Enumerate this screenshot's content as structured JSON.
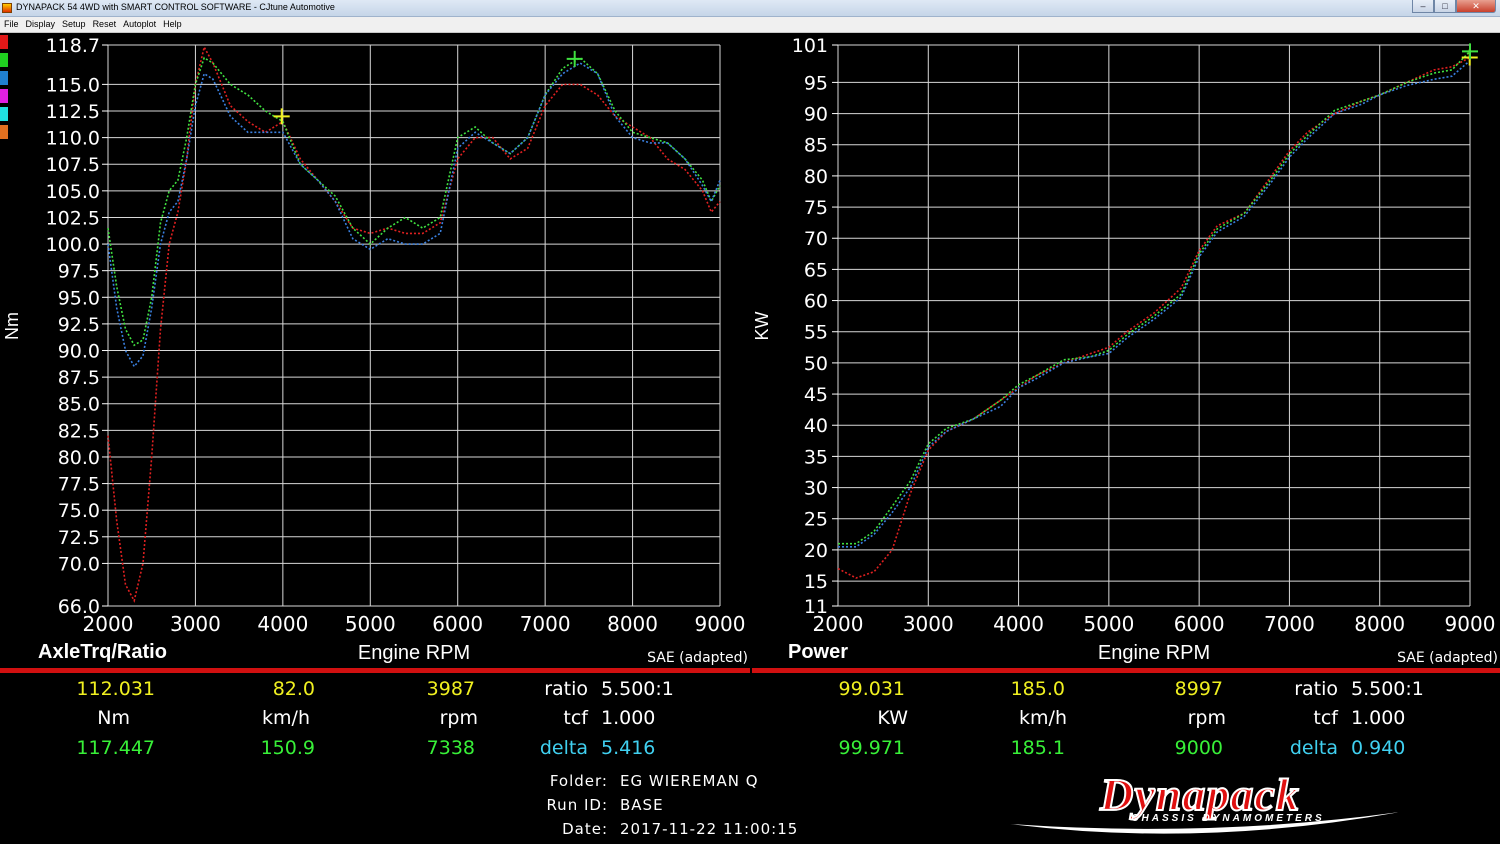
{
  "window": {
    "title": "DYNAPACK 54 4WD with SMART CONTROL SOFTWARE - CJtune Automotive",
    "menu": [
      "File",
      "Display",
      "Setup",
      "Reset",
      "Autoplot",
      "Help"
    ]
  },
  "legend_colors": [
    "#e01818",
    "#20d020",
    "#2080d0",
    "#e020e0",
    "#20e0e0",
    "#e07020"
  ],
  "colors": {
    "run_red": "#e02020",
    "run_green": "#40e040",
    "run_blue": "#3a80e0",
    "separator": "#d01010",
    "grid": "#d8d8d8"
  },
  "chart_data": [
    {
      "type": "line",
      "panel_title": "AxleTrq/Ratio",
      "xlabel": "Engine RPM",
      "ylabel": "Nm",
      "correction": "SAE (adapted)",
      "xlim": [
        2000,
        9000
      ],
      "ylim": [
        66.0,
        118.7
      ],
      "x_ticks": [
        2000,
        3000,
        4000,
        5000,
        6000,
        7000,
        8000,
        9000
      ],
      "y_ticks": [
        "66.0",
        "70.0",
        "72.5",
        "75.0",
        "77.5",
        "80.0",
        "82.5",
        "85.0",
        "87.5",
        "90.0",
        "92.5",
        "95.0",
        "97.5",
        "100.0",
        "102.5",
        "105.0",
        "107.5",
        "110.0",
        "112.5",
        "115.0",
        "118.7"
      ],
      "series": [
        {
          "color": "#e02020",
          "x": [
            2000,
            2100,
            2200,
            2300,
            2400,
            2500,
            2600,
            2700,
            2800,
            2900,
            3000,
            3100,
            3200,
            3400,
            3600,
            3800,
            4000,
            4200,
            4400,
            4600,
            4800,
            5000,
            5200,
            5400,
            5600,
            5800,
            6000,
            6200,
            6400,
            6600,
            6800,
            7000,
            7200,
            7400,
            7600,
            7800,
            8000,
            8200,
            8400,
            8600,
            8800,
            8900,
            9000
          ],
          "y": [
            82,
            74,
            68,
            66.5,
            70,
            80,
            92,
            100,
            103,
            108,
            115,
            118.5,
            117,
            113,
            111.5,
            110.5,
            111.5,
            108,
            106,
            104,
            101.5,
            101,
            101.5,
            101,
            101,
            102,
            108,
            110,
            110,
            108,
            109,
            113,
            115,
            115,
            114,
            112,
            111,
            110,
            108,
            107,
            105,
            103,
            104
          ]
        },
        {
          "color": "#40e040",
          "x": [
            2000,
            2100,
            2200,
            2300,
            2400,
            2500,
            2600,
            2700,
            2800,
            2900,
            3000,
            3100,
            3200,
            3400,
            3600,
            3800,
            4000,
            4200,
            4400,
            4600,
            4800,
            5000,
            5200,
            5400,
            5600,
            5800,
            6000,
            6200,
            6400,
            6600,
            6800,
            7000,
            7200,
            7400,
            7600,
            7800,
            8000,
            8200,
            8400,
            8600,
            8800,
            8900,
            9000
          ],
          "y": [
            101.5,
            96,
            92,
            90.5,
            91,
            95,
            102,
            105,
            106,
            110,
            115,
            117.5,
            117,
            115,
            114,
            112.5,
            111.5,
            107.5,
            106,
            104.5,
            101.5,
            100,
            101.5,
            102.5,
            101.5,
            102.5,
            110,
            111,
            109.5,
            108.5,
            110,
            114,
            116.5,
            117.5,
            116,
            112.5,
            110.5,
            110,
            109.5,
            108,
            106,
            104,
            105.5
          ]
        },
        {
          "color": "#3a80e0",
          "x": [
            2000,
            2100,
            2200,
            2300,
            2400,
            2500,
            2600,
            2700,
            2800,
            2900,
            3000,
            3100,
            3200,
            3400,
            3600,
            3800,
            4000,
            4200,
            4400,
            4600,
            4800,
            5000,
            5200,
            5400,
            5600,
            5800,
            6000,
            6200,
            6400,
            6600,
            6800,
            7000,
            7200,
            7400,
            7600,
            7800,
            8000,
            8200,
            8400,
            8600,
            8800,
            8900,
            9000
          ],
          "y": [
            100,
            94,
            90,
            88.5,
            89.5,
            94,
            100,
            103,
            104,
            108,
            113,
            116,
            115.5,
            112,
            110.5,
            110.5,
            110.5,
            107.5,
            106,
            104,
            100.5,
            99.5,
            100.5,
            100,
            100,
            101,
            109,
            110.5,
            109.5,
            108.5,
            110,
            114,
            116,
            117,
            116,
            112,
            110,
            109.5,
            109.5,
            108,
            105.5,
            104,
            106
          ]
        }
      ],
      "markers": [
        {
          "label": "cursor",
          "x": 3987,
          "y": 112.0,
          "color": "#f0f020"
        },
        {
          "label": "peak",
          "x": 7338,
          "y": 117.4,
          "color": "#40e040"
        }
      ]
    },
    {
      "type": "line",
      "panel_title": "Power",
      "xlabel": "Engine RPM",
      "ylabel": "KW",
      "correction": "SAE (adapted)",
      "xlim": [
        2000,
        9000
      ],
      "ylim": [
        11,
        101
      ],
      "x_ticks": [
        2000,
        3000,
        4000,
        5000,
        6000,
        7000,
        8000,
        9000
      ],
      "y_ticks": [
        "11",
        "15",
        "20",
        "25",
        "30",
        "35",
        "40",
        "45",
        "50",
        "55",
        "60",
        "65",
        "70",
        "75",
        "80",
        "85",
        "90",
        "95",
        "101"
      ],
      "series": [
        {
          "color": "#e02020",
          "x": [
            2000,
            2200,
            2400,
            2600,
            2800,
            3000,
            3200,
            3500,
            3800,
            4000,
            4200,
            4500,
            4800,
            5000,
            5200,
            5500,
            5800,
            6000,
            6200,
            6500,
            6800,
            7000,
            7200,
            7500,
            7800,
            8000,
            8300,
            8600,
            8800,
            9000
          ],
          "y": [
            17,
            15.5,
            16.5,
            20,
            29,
            36,
            39,
            41,
            44,
            46,
            48,
            50,
            51.5,
            52.5,
            55,
            58,
            62,
            68,
            72,
            74,
            80,
            84,
            87,
            90,
            92,
            93,
            95,
            97,
            97.5,
            99
          ]
        },
        {
          "color": "#40e040",
          "x": [
            2000,
            2200,
            2400,
            2600,
            2800,
            3000,
            3200,
            3500,
            3800,
            4000,
            4200,
            4500,
            4800,
            5000,
            5200,
            5500,
            5800,
            6000,
            6200,
            6500,
            6800,
            7000,
            7200,
            7500,
            7800,
            8000,
            8300,
            8600,
            8800,
            9000
          ],
          "y": [
            21,
            21,
            23,
            27,
            31,
            37,
            39.5,
            41,
            44,
            46.5,
            48,
            50.5,
            51,
            52,
            54.5,
            57.5,
            61,
            67.5,
            71.5,
            74,
            79.5,
            83.5,
            86.5,
            90.5,
            92,
            93,
            95,
            96.5,
            97,
            100
          ]
        },
        {
          "color": "#3a80e0",
          "x": [
            2000,
            2200,
            2400,
            2600,
            2800,
            3000,
            3200,
            3500,
            3800,
            4000,
            4200,
            4500,
            4800,
            5000,
            5200,
            5500,
            5800,
            6000,
            6200,
            6500,
            6800,
            7000,
            7200,
            7500,
            7800,
            8000,
            8300,
            8600,
            8800,
            9000
          ],
          "y": [
            20.5,
            20.5,
            22.5,
            26,
            30,
            36.5,
            39,
            41,
            43,
            46,
            47.5,
            50,
            51,
            51.5,
            54,
            57,
            60.5,
            67,
            71,
            73.5,
            79,
            83,
            86,
            90,
            91.5,
            93,
            94.5,
            95.5,
            96,
            98.5
          ]
        }
      ],
      "markers": [
        {
          "label": "cursor",
          "x": 8997,
          "y": 99.0,
          "color": "#f0f020"
        },
        {
          "label": "peak",
          "x": 9000,
          "y": 99.97,
          "color": "#40e040"
        }
      ]
    }
  ],
  "readouts": {
    "left": {
      "cursor": {
        "torque": "112.031",
        "speed": "82.0",
        "rpm": "3987"
      },
      "units": {
        "torque": "Nm",
        "speed": "km/h",
        "rpm": "rpm"
      },
      "peak": {
        "torque": "117.447",
        "speed": "150.9",
        "rpm": "7338"
      },
      "ratio_label": "ratio",
      "ratio": "5.500:1",
      "tcf_label": "tcf",
      "tcf": "1.000",
      "delta_label": "delta",
      "delta": "5.416"
    },
    "right": {
      "cursor": {
        "power": "99.031",
        "speed": "185.0",
        "rpm": "8997"
      },
      "units": {
        "power": "KW",
        "speed": "km/h",
        "rpm": "rpm"
      },
      "peak": {
        "power": "99.971",
        "speed": "185.1",
        "rpm": "9000"
      },
      "ratio_label": "ratio",
      "ratio": "5.500:1",
      "tcf_label": "tcf",
      "tcf": "1.000",
      "delta_label": "delta",
      "delta": "0.940"
    }
  },
  "run_info": {
    "folder_label": "Folder:",
    "folder": "EG WIEREMAN Q",
    "run_id_label": "Run ID:",
    "run_id": "BASE",
    "date_label": "Date:",
    "date": "2017-11-22 11:00:15"
  },
  "logo": {
    "brand": "Dynapack",
    "tagline": "CHASSIS DYNAMOMETERS"
  }
}
